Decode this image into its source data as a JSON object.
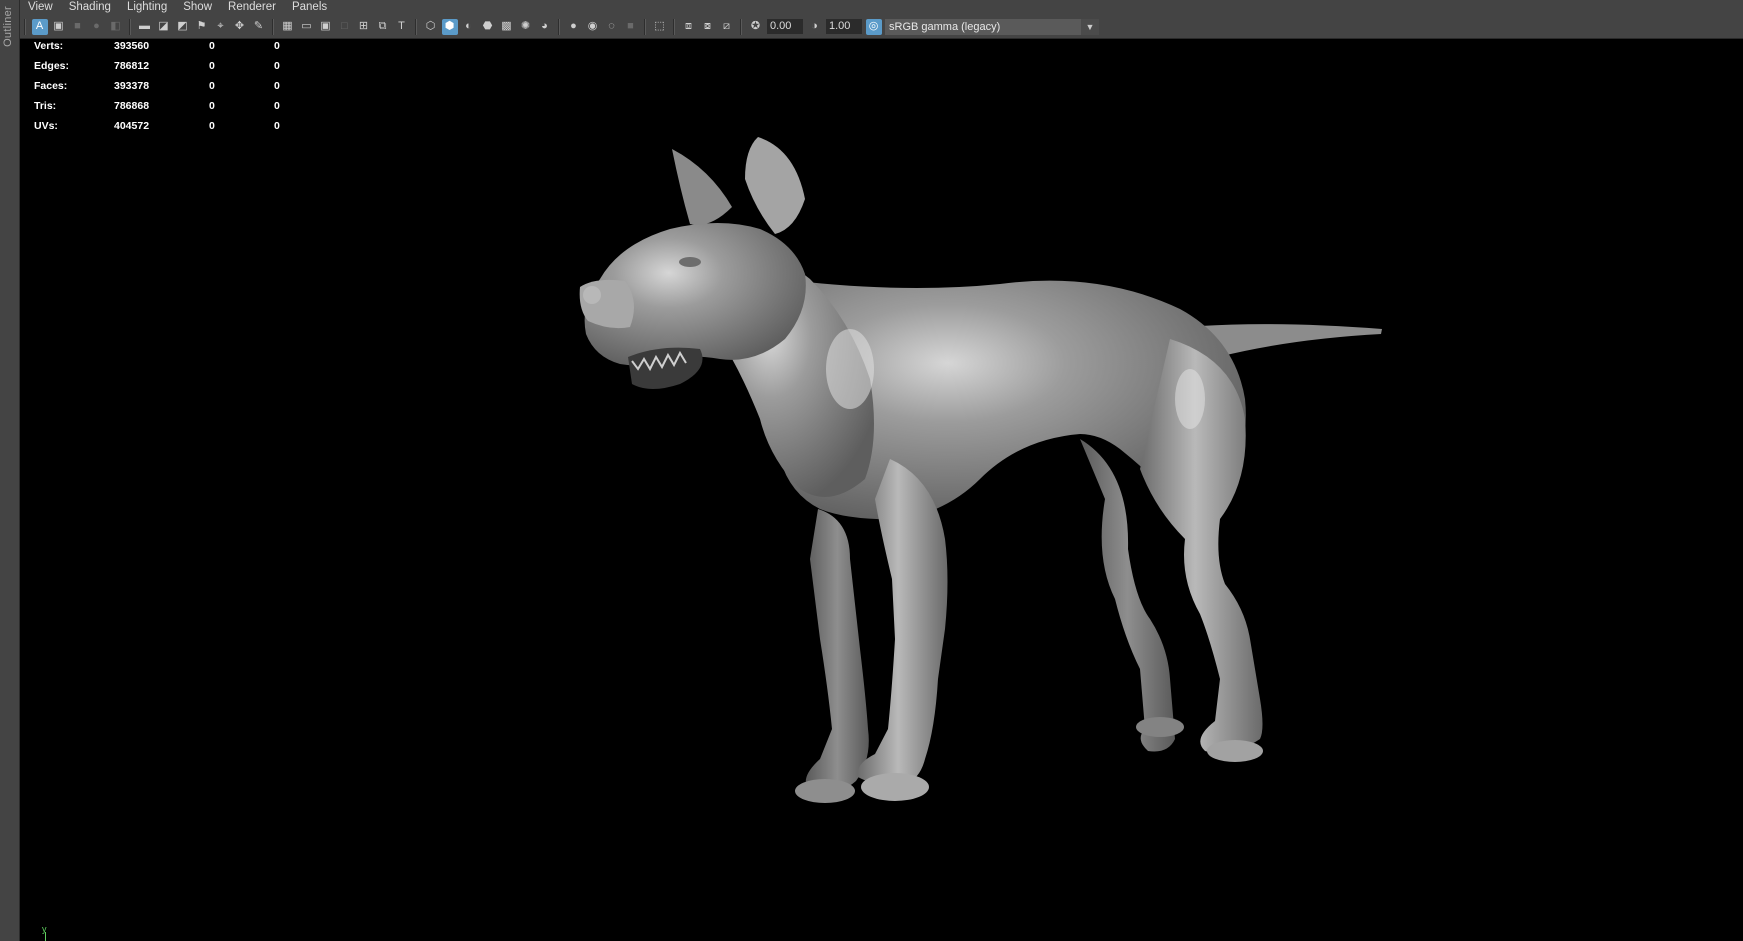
{
  "outliner": {
    "label": "Outliner"
  },
  "menu": [
    "View",
    "Shading",
    "Lighting",
    "Show",
    "Renderer",
    "Panels"
  ],
  "toolbar": {
    "exposure": "0.00",
    "gamma": "1.00",
    "color_space": "sRGB gamma (legacy)"
  },
  "hud": {
    "rows": [
      {
        "label": "Verts:",
        "v1": "393560",
        "v2": "0",
        "v3": "0"
      },
      {
        "label": "Edges:",
        "v1": "786812",
        "v2": "0",
        "v3": "0"
      },
      {
        "label": "Faces:",
        "v1": "393378",
        "v2": "0",
        "v3": "0"
      },
      {
        "label": "Tris:",
        "v1": "786868",
        "v2": "0",
        "v3": "0"
      },
      {
        "label": "UVs:",
        "v1": "404572",
        "v2": "0",
        "v3": "0"
      }
    ]
  },
  "axis": {
    "label": "y"
  },
  "colors": {
    "panel": "#444444",
    "viewport": "#000000",
    "accent": "#5b9bc9",
    "model": "#9a9a9a"
  },
  "viewport_model": {
    "icon": "dog-model"
  }
}
